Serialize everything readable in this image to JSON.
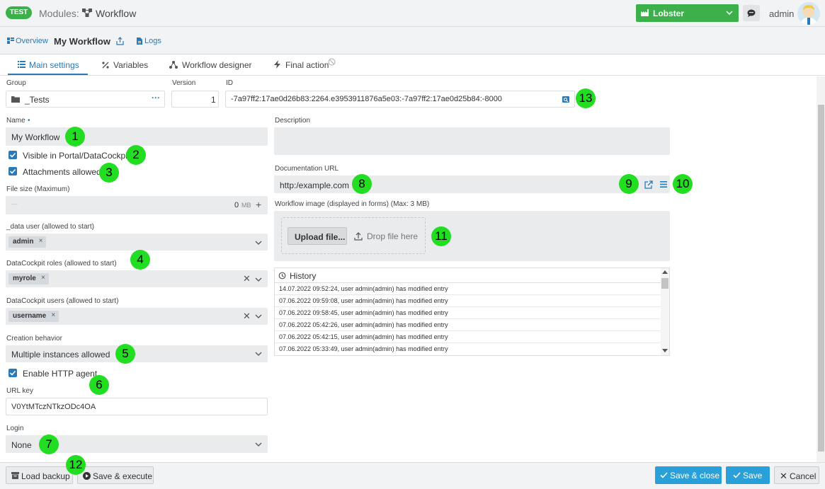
{
  "header": {
    "badge": "TEST",
    "modules_label": "Modules:",
    "title": "Workflow",
    "tenant": "Lobster",
    "user": "admin"
  },
  "subnav": {
    "overview": "Overview",
    "title": "My Workflow",
    "logs": "Logs"
  },
  "tabs": {
    "main": "Main settings",
    "variables": "Variables",
    "designer": "Workflow designer",
    "final": "Final action"
  },
  "form": {
    "group_label": "Group",
    "group_value": "_Tests",
    "version_label": "Version",
    "version_value": "1",
    "id_label": "ID",
    "id_value": "-7a97ff2:17ae0d26b83:2264.e3953911876a5e03:-7a97ff2:17ae0d25b84:-8000",
    "name_label": "Name",
    "name_required": "•",
    "name_value": "My Workflow",
    "visible_label": "Visible in Portal/DataCockpit",
    "attachments_label": "Attachments allowed",
    "filesize_label": "File size (Maximum)",
    "filesize_dash": "---",
    "filesize_value": "0",
    "filesize_unit": "MB",
    "datauser_label": "_data user (allowed to start)",
    "datauser_tag": "admin",
    "roles_label": "DataCockpit roles (allowed to start)",
    "roles_tag": "myrole",
    "users_label": "DataCockpit users (allowed to start)",
    "users_tag": "username",
    "creation_label": "Creation behavior",
    "creation_value": "Multiple instances allowed",
    "http_label": "Enable HTTP agent",
    "urlkey_label": "URL key",
    "urlkey_value": "V0YtMTczNTkzODc4OA",
    "login_label": "Login",
    "login_value": "None",
    "description_label": "Description",
    "docurl_label": "Documentation URL",
    "docurl_value": "http:/example.com",
    "image_label": "Workflow image (displayed in forms) (Max: 3 MB)",
    "upload_button": "Upload file...",
    "drop_text": "Drop file here"
  },
  "history": {
    "title": "History",
    "rows": [
      "14.07.2022 09:52:24, user admin(admin) has modified entry",
      "07.06.2022 09:59:08, user admin(admin) has modified entry",
      "07.06.2022 09:58:45, user admin(admin) has modified entry",
      "07.06.2022 05:42:26, user admin(admin) has modified entry",
      "07.06.2022 05:42:15, user admin(admin) has modified entry",
      "07.06.2022 05:33:49, user admin(admin) has modified entry"
    ]
  },
  "markers": [
    "1",
    "2",
    "3",
    "4",
    "5",
    "6",
    "7",
    "8",
    "9",
    "10",
    "11",
    "12",
    "13"
  ],
  "footer": {
    "load_backup": "Load backup",
    "save_execute": "Save & execute",
    "save_close": "Save & close",
    "save": "Save",
    "cancel": "Cancel"
  },
  "colors": {
    "accent": "#2a7ab8",
    "green": "#3cb04a",
    "marker": "#22dd22",
    "primary_button": "#2aa0d8"
  }
}
